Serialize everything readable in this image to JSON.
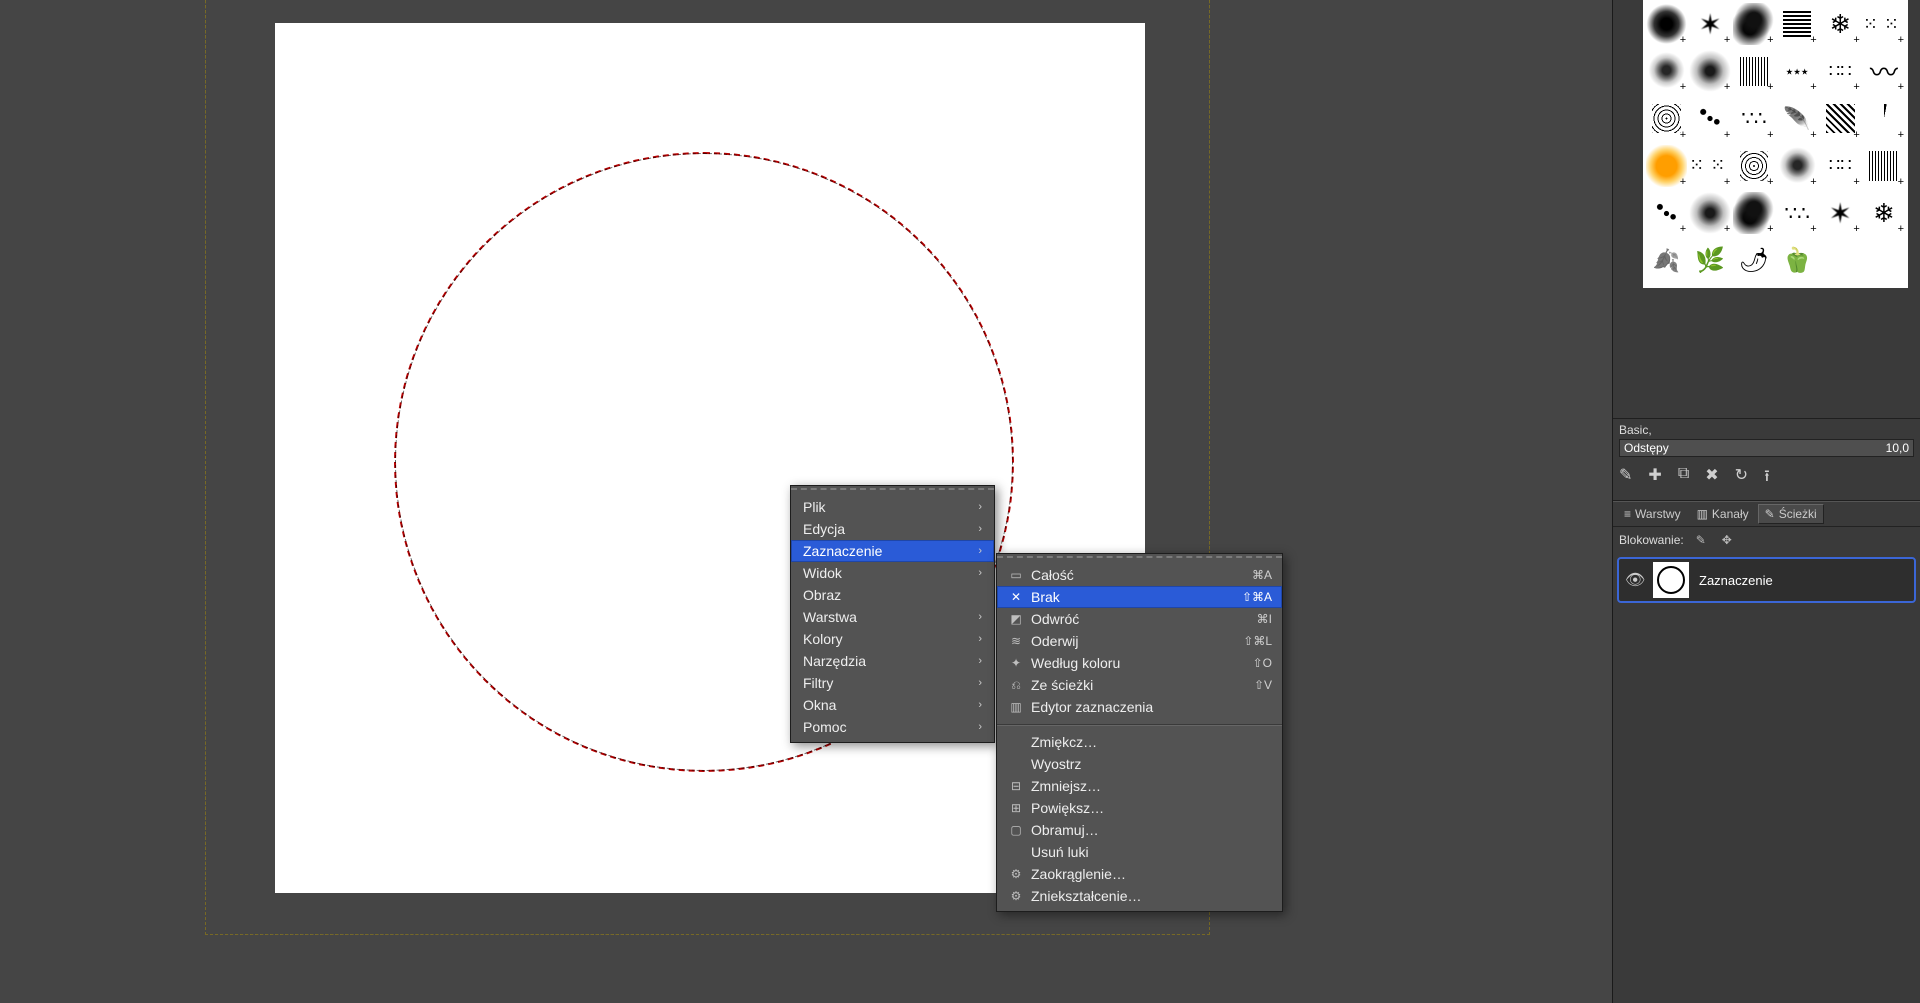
{
  "context_menu": {
    "items": [
      {
        "label": "Plik",
        "submenu": true
      },
      {
        "label": "Edycja",
        "submenu": true
      },
      {
        "label": "Zaznaczenie",
        "submenu": true,
        "selected": true
      },
      {
        "label": "Widok",
        "submenu": true
      },
      {
        "label": "Obraz",
        "submenu": false
      },
      {
        "label": "Warstwa",
        "submenu": true
      },
      {
        "label": "Kolory",
        "submenu": true
      },
      {
        "label": "Narzędzia",
        "submenu": true
      },
      {
        "label": "Filtry",
        "submenu": true
      },
      {
        "label": "Okna",
        "submenu": true
      },
      {
        "label": "Pomoc",
        "submenu": true
      }
    ]
  },
  "selection_submenu": {
    "groups": [
      [
        {
          "icon": "select-all-icon",
          "label": "Całość",
          "shortcut": "⌘A"
        },
        {
          "icon": "select-none-icon",
          "label": "Brak",
          "shortcut": "⇧⌘A",
          "selected": true
        },
        {
          "icon": "select-invert-icon",
          "label": "Odwróć",
          "shortcut": "⌘I"
        },
        {
          "icon": "select-float-icon",
          "label": "Oderwij",
          "shortcut": "⇧⌘L"
        },
        {
          "icon": "select-bycolor-icon",
          "label": "Według koloru",
          "shortcut": "⇧O"
        },
        {
          "icon": "select-frompath-icon",
          "label": "Ze ścieżki",
          "shortcut": "⇧V"
        },
        {
          "icon": "select-editor-icon",
          "label": "Edytor zaznaczenia",
          "shortcut": ""
        }
      ],
      [
        {
          "icon": "",
          "label": "Zmiękcz…",
          "shortcut": ""
        },
        {
          "icon": "",
          "label": "Wyostrz",
          "shortcut": ""
        },
        {
          "icon": "select-shrink-icon",
          "label": "Zmniejsz…",
          "shortcut": ""
        },
        {
          "icon": "select-grow-icon",
          "label": "Powiększ…",
          "shortcut": ""
        },
        {
          "icon": "select-border-icon",
          "label": "Obramuj…",
          "shortcut": ""
        },
        {
          "icon": "",
          "label": "Usuń luki",
          "shortcut": ""
        },
        {
          "icon": "select-round-icon",
          "label": "Zaokrąglenie…",
          "shortcut": ""
        },
        {
          "icon": "select-distort-icon",
          "label": "Zniekształcenie…",
          "shortcut": ""
        }
      ]
    ]
  },
  "brushes": {
    "info_label": "Basic,",
    "spacing_label": "Odstępy",
    "spacing_value": "10,0"
  },
  "tabs": {
    "layers": "Warstwy",
    "channels": "Kanały",
    "paths": "Ścieżki"
  },
  "lock_label": "Blokowanie:",
  "paths_item": {
    "name": "Zaznaczenie"
  }
}
